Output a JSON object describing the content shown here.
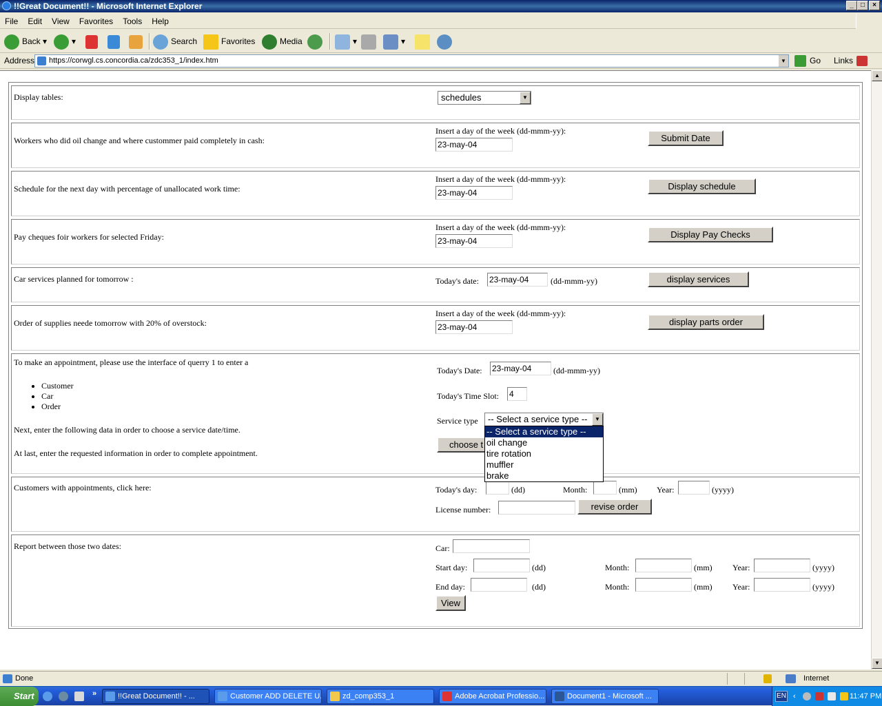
{
  "window": {
    "title": "!!Great Document!! - Microsoft Internet Explorer"
  },
  "menu": [
    "File",
    "Edit",
    "View",
    "Favorites",
    "Tools",
    "Help"
  ],
  "toolbar": {
    "back": "Back",
    "search": "Search",
    "favorites": "Favorites",
    "media": "Media"
  },
  "address": {
    "label": "Address",
    "url": "https://corwgl.cs.concordia.ca/zdc353_1/index.htm",
    "go": "Go",
    "links": "Links"
  },
  "rows": {
    "display_tables": {
      "label": "Display tables:",
      "selected": "schedules"
    },
    "oil_change": {
      "label": "Workers who did oil change and where custommer paid completely in cash:",
      "prompt": "Insert a day of the week (dd-mmm-yy):",
      "value": "23-may-04",
      "button": "Submit Date"
    },
    "schedule": {
      "label": "Schedule for the next day with percentage of unallocated work time:",
      "prompt": "Insert a day of the week (dd-mmm-yy):",
      "value": "23-may-04",
      "button": "Display schedule"
    },
    "paycheques": {
      "label": "Pay cheques foir workers for selected Friday:",
      "prompt": "Insert a day of the week (dd-mmm-yy):",
      "value": "23-may-04",
      "button": "Display Pay Checks"
    },
    "car_services": {
      "label": "Car services planned for tomorrow :",
      "prompt": "Today's date:",
      "value": "23-may-04",
      "suffix": "(dd-mmm-yy)",
      "button": "display services"
    },
    "supplies": {
      "label": "Order of supplies neede tomorrow with 20% of overstock:",
      "prompt": "Insert a day of the week (dd-mmm-yy):",
      "value": "23-may-04",
      "button": "display parts order"
    },
    "appointment": {
      "intro": "To make an appointment, please use the interface of querry 1 to enter a",
      "bullets": [
        "Customer",
        "Car",
        "Order"
      ],
      "next": "Next, enter the following data in order to choose a service date/time.",
      "last": "At last, enter the requested information in order to complete appointment.",
      "date_label": "Today's Date:",
      "date_value": "23-may-04",
      "date_suffix": "(dd-mmm-yy)",
      "slot_label": "Today's Time Slot:",
      "slot_value": "4",
      "service_label": "Service type",
      "service_selected": "-- Select a service type --",
      "button": "choose t",
      "options": [
        "-- Select a service type --",
        "oil change",
        "tire rotation",
        "muffler",
        "brake"
      ]
    },
    "customers": {
      "label": "Customers with appointments, click here:",
      "day_label": "Today's day:",
      "day_suffix": "(dd)",
      "month_label": "Month:",
      "month_suffix": "(mm)",
      "year_label": "Year:",
      "year_suffix": "(yyyy)",
      "license_label": "License number:",
      "button": "revise order"
    },
    "report": {
      "label": "Report between those two dates:",
      "car_label": "Car:",
      "start_label": "Start day:",
      "end_label": "End day:",
      "dd": "(dd)",
      "month_label": "Month:",
      "mm": "(mm)",
      "year_label": "Year:",
      "yyyy": "(yyyy)",
      "button": "View"
    }
  },
  "status": {
    "text": "Done",
    "zone": "Internet"
  },
  "taskbar": {
    "start": "Start",
    "tasks": [
      "!!Great Document!! - ...",
      "Customer ADD DELETE U...",
      "zd_comp353_1",
      "Adobe Acrobat Professio...",
      "Document1 - Microsoft ..."
    ],
    "lang": "EN",
    "time": "11:47 PM"
  }
}
